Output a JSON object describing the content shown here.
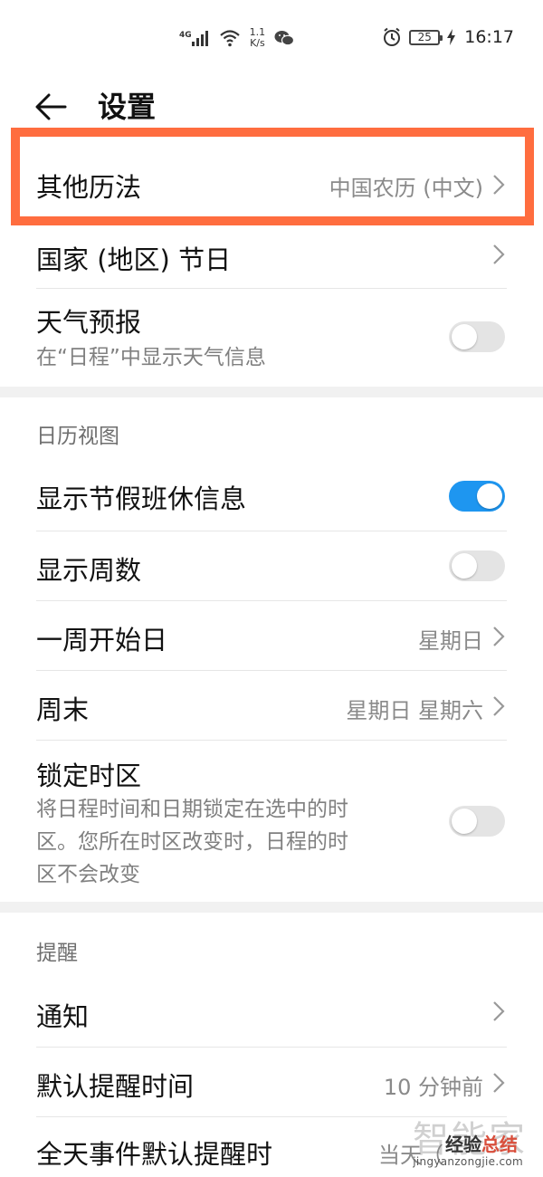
{
  "status_bar": {
    "network_type": "4G",
    "speed_value": "1.1",
    "speed_unit": "K/s",
    "battery": "25",
    "time": "16:17"
  },
  "header": {
    "title": "设置"
  },
  "rows": {
    "other_calendar": {
      "label": "其他历法",
      "value": "中国农历 (中文)"
    },
    "holidays": {
      "label": "国家 (地区) 节日"
    },
    "weather": {
      "label": "天气预报",
      "sublabel": "在“日程”中显示天气信息",
      "enabled": false
    },
    "show_holiday_info": {
      "label": "显示节假班休信息",
      "enabled": true
    },
    "show_week_number": {
      "label": "显示周数",
      "enabled": false
    },
    "week_start": {
      "label": "一周开始日",
      "value": "星期日"
    },
    "weekend": {
      "label": "周末",
      "value": "星期日 星期六"
    },
    "lock_timezone": {
      "label": "锁定时区",
      "sublabel_lines": [
        "将日程时间和日期锁定在选中的时",
        "区。您所在时区改变时，日程的时",
        "区不会改变"
      ],
      "enabled": false
    },
    "notification": {
      "label": "通知"
    },
    "default_reminder": {
      "label": "默认提醒时间",
      "value": "10 分钟前"
    },
    "allday_reminder": {
      "label": "全天事件默认提醒时",
      "value": "当天（"
    }
  },
  "sections": {
    "calendar_view": "日历视图",
    "reminder": "提醒"
  },
  "watermark": {
    "big": "智能家",
    "text_main": "经验",
    "text_accent": "总结",
    "url": "jingyanzongjie.com"
  },
  "colors": {
    "toggle_on": "#1e96f0",
    "toggle_off": "#e4e4e4",
    "highlight": "#ff6d3f"
  }
}
